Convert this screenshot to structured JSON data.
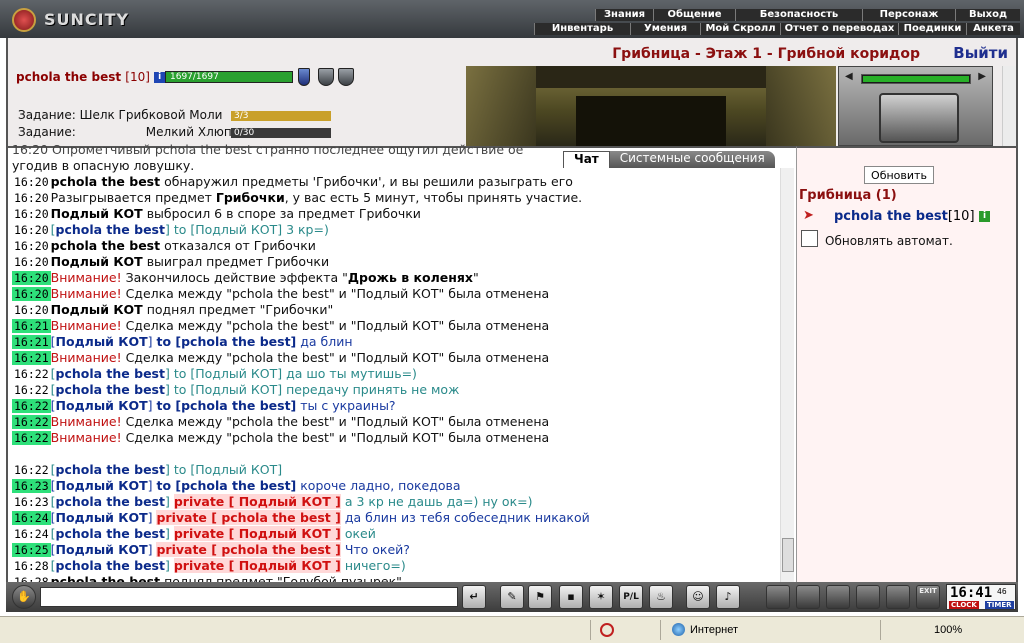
{
  "app": {
    "logo_text": "SUNCITY"
  },
  "menu_top": [
    "Знания",
    "Общение",
    "Безопасность",
    "Персонаж",
    "Выход"
  ],
  "menu_bottom": [
    "Инвентарь",
    "Умения",
    "Мой Скролл",
    "Отчет о переводах",
    "Поединки",
    "Анкета"
  ],
  "player": {
    "name": "pchola the best",
    "level": "[10]",
    "info": "i",
    "hp_text": "1697/1697",
    "hp_fraction": 1.0
  },
  "quests": [
    {
      "label": "Задание:",
      "name": "Шелк Грибковой Моли",
      "progress": "3/3",
      "fraction": 1.0
    },
    {
      "label": "Задание:",
      "name": "Мелкий Хлюп",
      "progress": "0/30",
      "fraction": 0.0
    }
  ],
  "location": {
    "title": "Грибница - Этаж 1 - Грибной коридор",
    "exit": "Выйти"
  },
  "chat_tabs": [
    "Чат",
    "Системные сообщения"
  ],
  "chat_first_line": "угодив в опасную ловушку.",
  "chat_first_partial": "16:20 Опрометчивый pchola the best странно последнее ощутил действие ое",
  "chat": [
    {
      "ts": "16:20",
      "hl": false,
      "parts": [
        {
          "t": "pchola the best",
          "c": "nm"
        },
        {
          "t": " обнаружил предметы 'Грибочки', и вы решили разыграть его",
          "c": ""
        }
      ]
    },
    {
      "ts": "16:20",
      "hl": false,
      "parts": [
        {
          "t": "Разыгрывается предмет ",
          "c": ""
        },
        {
          "t": "Грибочки",
          "c": "nm"
        },
        {
          "t": ", у вас есть 5 минут, чтобы принять участие.",
          "c": ""
        }
      ]
    },
    {
      "ts": "16:20",
      "hl": false,
      "parts": [
        {
          "t": "Подлый КОТ",
          "c": "nm"
        },
        {
          "t": " выбросил 6 в споре за предмет Грибочки",
          "c": ""
        }
      ]
    },
    {
      "ts": "16:20",
      "hl": false,
      "parts": [
        {
          "t": "[",
          "c": "teal"
        },
        {
          "t": "pchola the best",
          "c": "nm b"
        },
        {
          "t": "] to [Подлый КОТ] 3 кр=)",
          "c": "teal"
        }
      ]
    },
    {
      "ts": "16:20",
      "hl": false,
      "parts": [
        {
          "t": "pchola the best",
          "c": "nm"
        },
        {
          "t": " отказался от Грибочки",
          "c": ""
        }
      ]
    },
    {
      "ts": "16:20",
      "hl": false,
      "parts": [
        {
          "t": "Подлый КОТ",
          "c": "nm"
        },
        {
          "t": " выиграл предмет Грибочки",
          "c": ""
        }
      ]
    },
    {
      "ts": "16:20",
      "hl": true,
      "parts": [
        {
          "t": "Внимание!",
          "c": "red"
        },
        {
          "t": " Закончилось действие эффекта \"",
          "c": ""
        },
        {
          "t": "Дрожь в коленях",
          "c": "nm"
        },
        {
          "t": "\"",
          "c": ""
        }
      ]
    },
    {
      "ts": "16:20",
      "hl": true,
      "parts": [
        {
          "t": "Внимание!",
          "c": "red"
        },
        {
          "t": " Сделка между \"pchola the best\" и \"Подлый КОТ\" была отменена",
          "c": ""
        }
      ]
    },
    {
      "ts": "16:20",
      "hl": false,
      "parts": [
        {
          "t": "Подлый КОТ",
          "c": "nm"
        },
        {
          "t": " поднял предмет \"Грибочки\"",
          "c": ""
        }
      ]
    },
    {
      "ts": "16:21",
      "hl": true,
      "parts": [
        {
          "t": "Внимание!",
          "c": "red"
        },
        {
          "t": " Сделка между \"pchola the best\" и \"Подлый КОТ\" была отменена",
          "c": ""
        }
      ]
    },
    {
      "ts": "16:21",
      "hl": true,
      "parts": [
        {
          "t": "[",
          "c": "blu"
        },
        {
          "t": "Подлый КОТ",
          "c": "nm b"
        },
        {
          "t": "] ",
          "c": "blu"
        },
        {
          "t": "to [pchola the best]",
          "c": "to"
        },
        {
          "t": " да блин",
          "c": "blu"
        }
      ]
    },
    {
      "ts": "16:21",
      "hl": true,
      "parts": [
        {
          "t": "Внимание!",
          "c": "red"
        },
        {
          "t": " Сделка между \"pchola the best\" и \"Подлый КОТ\" была отменена",
          "c": ""
        }
      ]
    },
    {
      "ts": "16:22",
      "hl": false,
      "parts": [
        {
          "t": "[",
          "c": "teal"
        },
        {
          "t": "pchola the best",
          "c": "nm b"
        },
        {
          "t": "] to [Подлый КОТ] да шо ты мутишь=)",
          "c": "teal"
        }
      ]
    },
    {
      "ts": "16:22",
      "hl": false,
      "parts": [
        {
          "t": "[",
          "c": "teal"
        },
        {
          "t": "pchola the best",
          "c": "nm b"
        },
        {
          "t": "] to [Подлый КОТ] передачу принять не мож",
          "c": "teal"
        }
      ]
    },
    {
      "ts": "16:22",
      "hl": true,
      "parts": [
        {
          "t": "[",
          "c": "blu"
        },
        {
          "t": "Подлый КОТ",
          "c": "nm b"
        },
        {
          "t": "] ",
          "c": "blu"
        },
        {
          "t": "to [pchola the best]",
          "c": "to"
        },
        {
          "t": " ты с украины?",
          "c": "blu"
        }
      ]
    },
    {
      "ts": "16:22",
      "hl": true,
      "parts": [
        {
          "t": "Внимание!",
          "c": "red"
        },
        {
          "t": " Сделка между \"pchola the best\" и \"Подлый КОТ\" была отменена",
          "c": ""
        }
      ]
    },
    {
      "ts": "16:22",
      "hl": true,
      "parts": [
        {
          "t": "Внимание!",
          "c": "red"
        },
        {
          "t": " Сделка между \"pchola the best\" и \"Подлый КОТ\" была отменена",
          "c": ""
        }
      ]
    },
    {
      "ts": "",
      "hl": false,
      "parts": []
    },
    {
      "ts": "16:22",
      "hl": false,
      "parts": [
        {
          "t": "[",
          "c": "teal"
        },
        {
          "t": "pchola the best",
          "c": "nm b"
        },
        {
          "t": "] to [Подлый КОТ]",
          "c": "teal"
        }
      ]
    },
    {
      "ts": "16:23",
      "hl": true,
      "parts": [
        {
          "t": "[",
          "c": "blu"
        },
        {
          "t": "Подлый КОТ",
          "c": "nm b"
        },
        {
          "t": "] ",
          "c": "blu"
        },
        {
          "t": "to [pchola the best]",
          "c": "to"
        },
        {
          "t": " короче ладно, покедова",
          "c": "blu"
        }
      ]
    },
    {
      "ts": "16:23",
      "hl": false,
      "parts": [
        {
          "t": "[",
          "c": "teal"
        },
        {
          "t": "pchola the best",
          "c": "nm b"
        },
        {
          "t": "] ",
          "c": "teal"
        },
        {
          "t": "private [ Подлый КОТ ]",
          "c": "priv"
        },
        {
          "t": " а 3 кр не дашь да=) ну ок=)",
          "c": "teal"
        }
      ]
    },
    {
      "ts": "16:24",
      "hl": true,
      "parts": [
        {
          "t": "[",
          "c": "blu"
        },
        {
          "t": "Подлый КОТ",
          "c": "nm b"
        },
        {
          "t": "] ",
          "c": "blu"
        },
        {
          "t": "private [ pchola the best ]",
          "c": "priv"
        },
        {
          "t": " да блин из тебя собеседник никакой",
          "c": "blu"
        }
      ]
    },
    {
      "ts": "16:24",
      "hl": false,
      "parts": [
        {
          "t": "[",
          "c": "teal"
        },
        {
          "t": "pchola the best",
          "c": "nm b"
        },
        {
          "t": "] ",
          "c": "teal"
        },
        {
          "t": "private [ Подлый КОТ ]",
          "c": "priv"
        },
        {
          "t": " окей",
          "c": "teal"
        }
      ]
    },
    {
      "ts": "16:25",
      "hl": true,
      "parts": [
        {
          "t": "[",
          "c": "blu"
        },
        {
          "t": "Подлый КОТ",
          "c": "nm b"
        },
        {
          "t": "] ",
          "c": "blu"
        },
        {
          "t": "private [ pchola the best ]",
          "c": "priv"
        },
        {
          "t": " Что окей?",
          "c": "blu"
        }
      ]
    },
    {
      "ts": "16:28",
      "hl": false,
      "parts": [
        {
          "t": "[",
          "c": "teal"
        },
        {
          "t": "pchola the best",
          "c": "nm b"
        },
        {
          "t": "] ",
          "c": "teal"
        },
        {
          "t": "private [ Подлый КОТ ]",
          "c": "priv"
        },
        {
          "t": " ничего=)",
          "c": "teal"
        }
      ]
    },
    {
      "ts": "16:28",
      "hl": false,
      "parts": [
        {
          "t": "pchola the best",
          "c": "nm"
        },
        {
          "t": " поднял предмет \"Голубой пузырек\"",
          "c": ""
        }
      ]
    }
  ],
  "side": {
    "refresh": "Обновить",
    "room": "Грибница (1)",
    "user": "pchola the best",
    "user_level": "[10]",
    "user_info": "i",
    "auto_refresh": "Обновлять автомат."
  },
  "toolbar": {
    "buttons": [
      "↵",
      "✎",
      "⚑",
      "▪",
      "✶",
      "P/L",
      "♨",
      "☺",
      "♪"
    ],
    "exit_label": "EXIT"
  },
  "clock": {
    "time": "16:41",
    "seconds": "46",
    "clock_label": "CLOCK",
    "timer_label": "TIMER"
  },
  "statusbar": {
    "zone": "Интернет",
    "zoom": "100%"
  }
}
